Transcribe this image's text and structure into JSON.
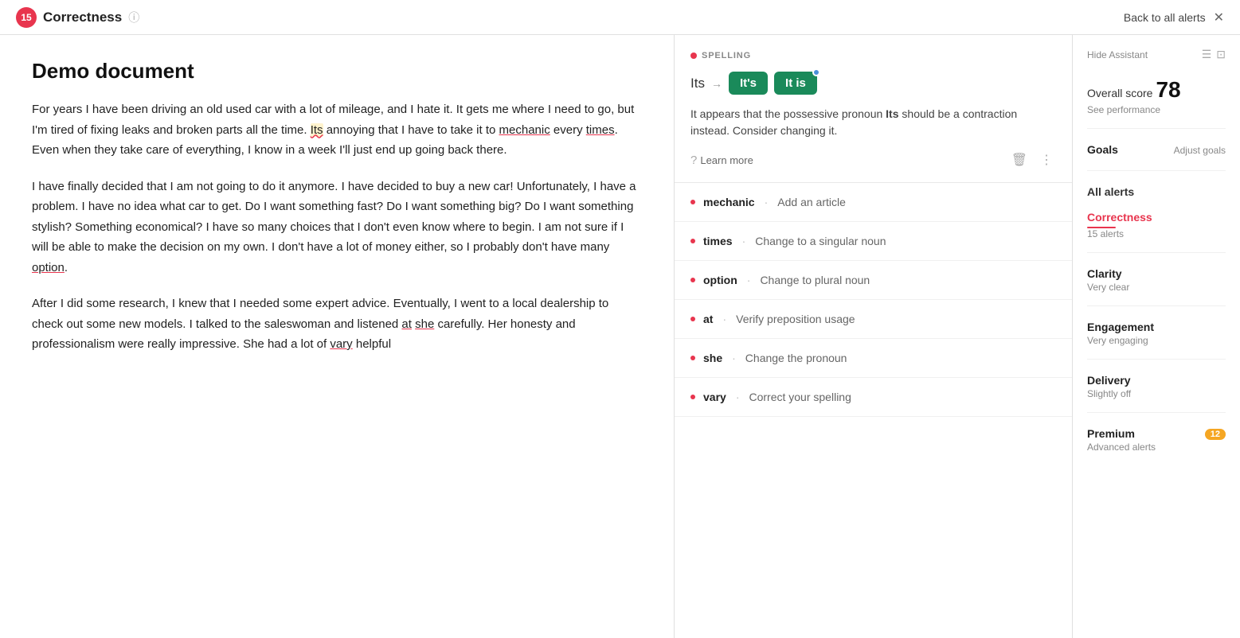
{
  "topbar": {
    "badge_count": "15",
    "title": "Correctness",
    "info_icon": "ⓘ",
    "back_label": "Back to all alerts",
    "close_icon": "✕"
  },
  "document": {
    "title": "Demo document",
    "paragraphs": [
      "For years I have been driving an old used car with a lot of mileage, and I hate it. It gets me where I need to go, but I'm tired of fixing leaks and broken parts all the time. Its annoying that I have to take it to mechanic every times. Even when they take care of everything, I know in a week I'll just end up going back there.",
      "I have finally decided that I am not going to do it anymore. I have decided to buy a new car! Unfortunately, I have a problem. I have no idea what car to get. Do I want something fast? Do I want something big? Do I want something stylish? Something economical? I have so many choices that I don't even know where to begin. I am not sure if I will be able to make the decision on my own. I don't have a lot of money either, so I probably don't have many option.",
      "After I did some research, I knew that I needed some expert advice. Eventually, I went to a local dealership to check out some new models. I talked to the saleswoman and listened at she carefully. Her honesty and professionalism were really impressive. She had a lot of vary helpful"
    ]
  },
  "spelling_card": {
    "label": "SPELLING",
    "original_word": "Its",
    "arrow": "→",
    "suggestion1": "It's",
    "suggestion2": "It is",
    "description_before": "It appears that the possessive pronoun ",
    "description_bold": "Its",
    "description_after": " should be a contraction instead. Consider changing it.",
    "learn_more": "Learn more",
    "delete_icon": "🗑",
    "more_icon": "⋮"
  },
  "alerts": [
    {
      "word": "mechanic",
      "separator": "·",
      "suggestion": "Add an article"
    },
    {
      "word": "times",
      "separator": "·",
      "suggestion": "Change to a singular noun"
    },
    {
      "word": "option",
      "separator": "·",
      "suggestion": "Change to plural noun"
    },
    {
      "word": "at",
      "separator": "·",
      "suggestion": "Verify preposition usage"
    },
    {
      "word": "she",
      "separator": "·",
      "suggestion": "Change the pronoun"
    },
    {
      "word": "vary",
      "separator": "·",
      "suggestion": "Correct your spelling"
    }
  ],
  "right_sidebar": {
    "hide_assistant": "Hide Assistant",
    "overall_score_label": "Overall score",
    "overall_score_number": "78",
    "see_performance": "See performance",
    "goals_label": "Goals",
    "adjust_goals": "Adjust goals",
    "all_alerts_label": "All alerts",
    "correctness_label": "Correctness",
    "correctness_alerts": "15 alerts",
    "clarity_label": "Clarity",
    "clarity_sub": "Very clear",
    "engagement_label": "Engagement",
    "engagement_sub": "Very engaging",
    "delivery_label": "Delivery",
    "delivery_sub": "Slightly off",
    "premium_label": "Premium",
    "premium_badge": "12",
    "premium_sub": "Advanced alerts"
  }
}
